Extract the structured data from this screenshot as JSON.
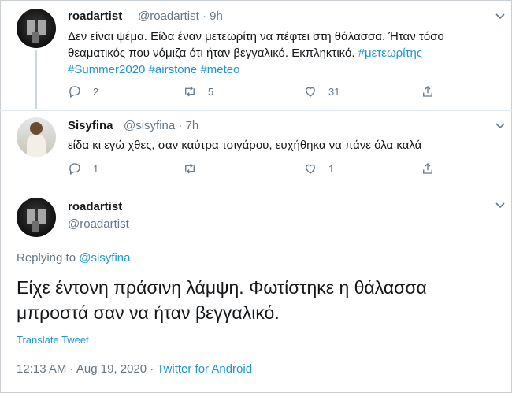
{
  "tweets": [
    {
      "name": "roadartist",
      "handle": "@roadartist",
      "time": "9h",
      "text_plain": "Δεν είναι ψέμα. Είδα έναν μετεωρίτη να πέφτει στη θάλασσα. Ήταν τόσο θεαματικός που νόμιζα ότι ήταν βεγγαλικό. Εκπληκτικό.",
      "hashtags": [
        "#μετεωρίτης",
        "#Summer2020",
        "#airstone",
        "#meteo"
      ],
      "replies": "2",
      "retweets": "5",
      "likes": "31"
    },
    {
      "name": "Sisyfina",
      "handle": "@sisyfina",
      "time": "7h",
      "text_plain": "είδα κι εγώ χθες, σαν καύτρα τσιγάρου, ευχήθηκα να πάνε όλα καλά",
      "replies": "1",
      "retweets": "",
      "likes": "1"
    }
  ],
  "main": {
    "name": "roadartist",
    "handle": "@roadartist",
    "replying_label": "Replying to",
    "replying_handle": "@sisyfina",
    "text_line1": "Είχε έντονη πράσινη λάμψη. Φωτίστηκε η θάλασσα",
    "text_line2": "μπροστά σαν να ήταν βεγγαλικό.",
    "translate_label": "Translate Tweet",
    "timestamp": "12:13 AM · Aug 19, 2020 · ",
    "source": "Twitter for Android"
  },
  "separator": "·",
  "icons": {
    "reply": "reply-icon",
    "retweet": "retweet-icon",
    "like": "like-icon",
    "share": "share-icon",
    "more": "chevron-down-icon"
  },
  "colors": {
    "link": "#1b95e0",
    "secondary": "#657786",
    "text": "#14171a"
  }
}
